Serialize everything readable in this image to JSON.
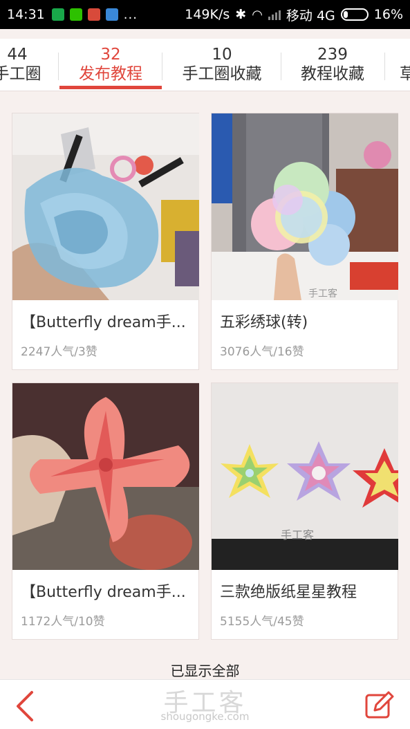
{
  "status_bar": {
    "time": "14:31",
    "more": "...",
    "speed": "149K/s",
    "carrier": "移动 4G",
    "battery": "16%"
  },
  "tabs": [
    {
      "count": "44",
      "label": "手工圈"
    },
    {
      "count": "32",
      "label": "发布教程"
    },
    {
      "count": "10",
      "label": "手工圈收藏"
    },
    {
      "count": "239",
      "label": "教程收藏"
    },
    {
      "count": "",
      "label": "草"
    }
  ],
  "tutorials": [
    {
      "title": "【Butterfly dream手...",
      "stats": "2247人气/3赞"
    },
    {
      "title": "五彩绣球(转)",
      "stats": "3076人气/16赞"
    },
    {
      "title": "【Butterfly dream手...",
      "stats": "1172人气/10赞"
    },
    {
      "title": "三款绝版纸星星教程",
      "stats": "5155人气/45赞"
    }
  ],
  "watermarks": {
    "card2": "手工客",
    "card4": "手工客"
  },
  "footer_note": "已显示全部",
  "bottom_bar": {
    "brand": "手工客",
    "brand_url": "shougongke.com"
  },
  "colors": {
    "accent": "#e0463c",
    "background": "#f7f0ee"
  }
}
